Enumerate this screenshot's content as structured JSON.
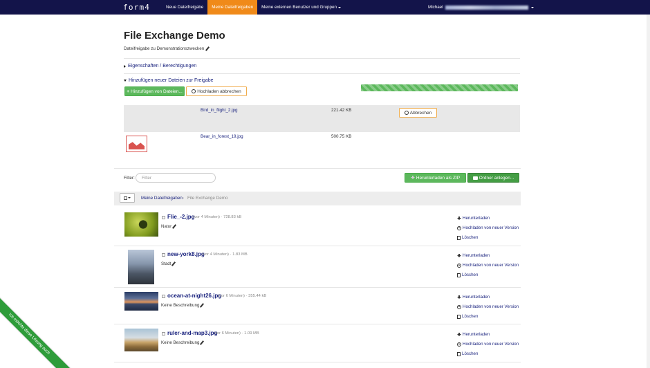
{
  "nav": {
    "brand": "form4",
    "items": [
      {
        "label": "Neue Dateifreigabe",
        "active": false
      },
      {
        "label": "Meine Dateifreigaben",
        "active": true
      },
      {
        "label": "Meine externen Benutzer und Gruppen",
        "active": false
      }
    ],
    "user": "Michael",
    "accent": "#f08a19",
    "bg": "#13144a"
  },
  "page": {
    "title": "File Exchange Demo",
    "subtitle": "Dateifreigabe zu Demonstrationszwecken"
  },
  "sections": {
    "properties": "Eigenschaften / Berechtigungen",
    "add_files": "Hinzufügen neuer Dateien zur Freigabe"
  },
  "upload": {
    "add_button": "Hinzufügen von Dateien...",
    "cancel_upload_button": "Hochladen abbrechen",
    "progress": 1.0,
    "queue": [
      {
        "name": "Bird_in_flight_2.jpg",
        "size": "221.42 KB",
        "cancel_label": "Abbrechen"
      },
      {
        "name": "Bear_in_forest_19.jpg",
        "size": "500.75 KB"
      }
    ]
  },
  "toolbar": {
    "filter_label": "Filter:",
    "filter_placeholder": "Filter",
    "download_zip": "Herunterladen als ZIP",
    "new_folder": "Ordner anlegen..."
  },
  "breadcrumb": {
    "root": "Meine Dateifreigaben",
    "separator": "›",
    "current": "File Exchange Demo"
  },
  "files": [
    {
      "name": "Flie_-2.jpg",
      "meta": "(vor 4 Minuten) · 728.83 kB",
      "desc": "Natur"
    },
    {
      "name": "new-york8.jpg",
      "meta": "(vor 4 Minuten) · 1.83 MB",
      "desc": "Stadt"
    },
    {
      "name": "ocean-at-night26.jpg",
      "meta": "(vor 6 Minuten) · 355.44 kB",
      "desc": "Keine Beschreibung"
    },
    {
      "name": "ruler-and-map3.jpg",
      "meta": "(vor 6 Minuten) · 1.09 MB",
      "desc": "Keine Beschreibung"
    }
  ],
  "file_actions": {
    "download": "Herunterladen",
    "upload_new": "Hochladen von neuer Version",
    "delete": "Löschen"
  },
  "ribbon": "Ich möchte diese Lösung auch"
}
